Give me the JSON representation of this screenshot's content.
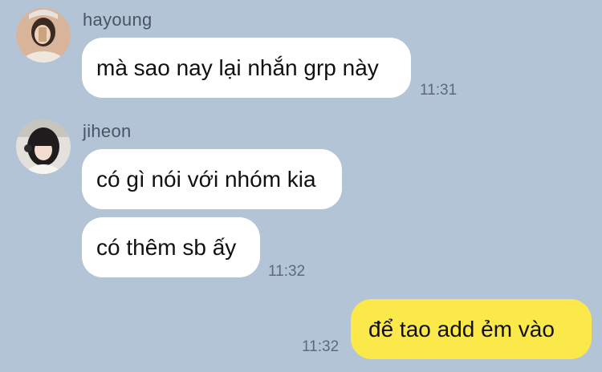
{
  "messages": [
    {
      "sender": "hayoung",
      "avatar_icon": "hayoung-avatar-icon",
      "text": "mà sao nay lại nhắn grp này",
      "time": "11:31"
    },
    {
      "sender": "jiheon",
      "avatar_icon": "jiheon-avatar-icon",
      "text": "có gì nói với nhóm kia"
    },
    {
      "text": "có thêm sb ấy",
      "time": "11:32"
    },
    {
      "own": true,
      "text": "để tao add ẻm vào",
      "time": "11:32"
    }
  ],
  "colors": {
    "background": "#b2c4d6",
    "incoming_bubble": "#ffffff",
    "outgoing_bubble": "#fbe84b"
  }
}
